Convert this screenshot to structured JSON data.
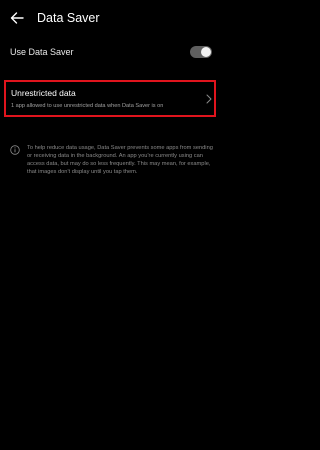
{
  "header": {
    "title": "Data Saver",
    "back_icon": "arrow-left-icon"
  },
  "data_saver": {
    "label": "Use Data Saver",
    "enabled": false
  },
  "unrestricted": {
    "title": "Unrestricted data",
    "subtitle": "1 app allowed to use unrestricted data when Data Saver is on",
    "icon": "chevron-right-icon"
  },
  "info": {
    "icon": "info-icon",
    "text": "To help reduce data usage, Data Saver prevents some apps from sending or receiving data in the background. An app you're currently using can access data, but may do so less frequently. This may mean, for example, that images don't display until you tap them."
  },
  "colors": {
    "background": "#000000",
    "highlight_border": "#e0141d",
    "toggle_track": "#5f5f5f"
  }
}
